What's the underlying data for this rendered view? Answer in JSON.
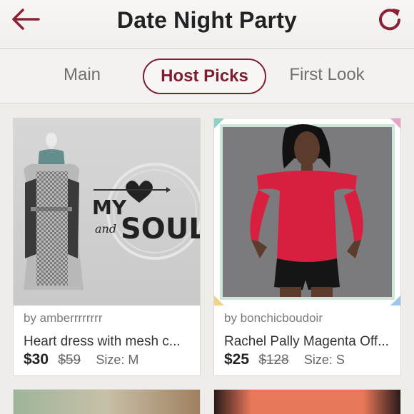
{
  "header": {
    "title": "Date Night Party",
    "back_icon": "arrow-left-icon",
    "refresh_icon": "refresh-icon",
    "accent": "#7d1d2f"
  },
  "tabs": [
    {
      "label": "Main",
      "active": false
    },
    {
      "label": "Host Picks",
      "active": true
    },
    {
      "label": "First Look",
      "active": false
    }
  ],
  "listings": [
    {
      "seller": "by amberrrrrrrr",
      "title": "Heart dress with mesh c...",
      "price": "$30",
      "original_price": "$59",
      "size": "Size: M",
      "image_text": {
        "line1": "MY",
        "line2": "and",
        "line3": "SOUL"
      }
    },
    {
      "seller": "by bonchicboudoir",
      "title": "Rachel Pally Magenta Off...",
      "price": "$25",
      "original_price": "$128",
      "size": "Size: S"
    }
  ]
}
